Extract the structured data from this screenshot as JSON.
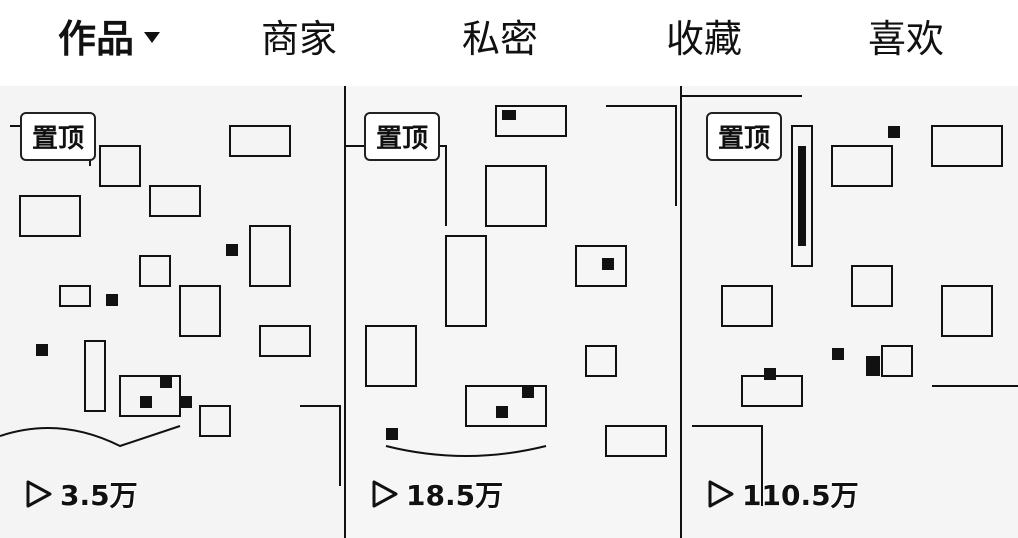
{
  "tabs": [
    {
      "label": "作品",
      "active": true,
      "has_dropdown": true
    },
    {
      "label": "商家",
      "active": false
    },
    {
      "label": "私密",
      "active": false
    },
    {
      "label": "收藏",
      "active": false
    },
    {
      "label": "喜欢",
      "active": false
    }
  ],
  "videos": [
    {
      "pin_label": "置顶",
      "play_count": "3.5万",
      "icon": "play-icon"
    },
    {
      "pin_label": "置顶",
      "play_count": "18.5万",
      "icon": "play-icon"
    },
    {
      "pin_label": "置顶",
      "play_count": "110.5万",
      "icon": "play-icon"
    }
  ],
  "colors": {
    "text": "#111111",
    "background": "#ffffff",
    "tile_bg": "#f7f7f7"
  }
}
